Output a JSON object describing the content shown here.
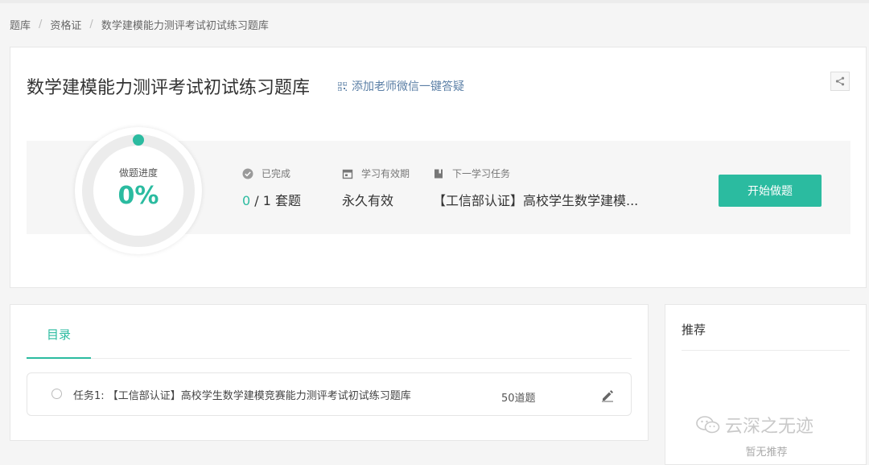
{
  "breadcrumb": [
    "题库",
    "资格证",
    "数学建模能力测评考试初试练习题库"
  ],
  "page": {
    "title": "数学建模能力测评考试初试练习题库",
    "wechat_link": "添加老师微信一键答疑",
    "share_icon": "share-icon"
  },
  "progress": {
    "label": "做题进度",
    "value_text": "0%",
    "fraction": 0,
    "accent": "#2bbba0"
  },
  "stats": {
    "completed_label": "已完成",
    "completed_done": "0",
    "completed_rest": " / 1 套题",
    "validity_label": "学习有效期",
    "validity_value": "永久有效",
    "next_label": "下一学习任务",
    "next_value": "【工信部认证】高校学生数学建模..."
  },
  "start_button": "开始做题",
  "toc": {
    "tab_label": "目录",
    "task": {
      "name": "任务1: 【工信部认证】高校学生数学建模竞赛能力测评考试初试练习题库",
      "count": "50道题"
    }
  },
  "recommend": {
    "title": "推荐",
    "empty": "暂无推荐"
  },
  "watermark": "云深之无迹"
}
